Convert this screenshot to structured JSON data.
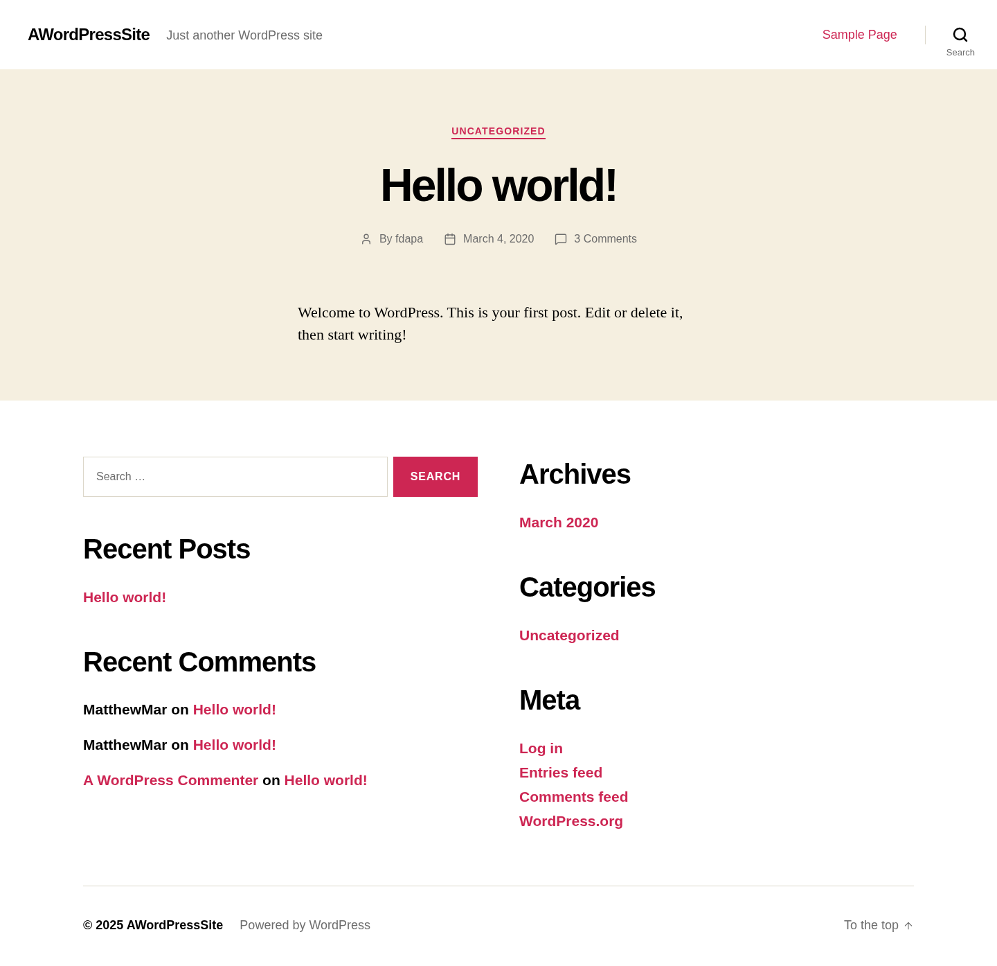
{
  "header": {
    "site_title": "AWordPressSite",
    "tagline": "Just another WordPress site",
    "menu": [
      {
        "label": "Sample Page"
      }
    ],
    "search_toggle": {
      "label": "Search"
    }
  },
  "post": {
    "category": "UNCATEGORIZED",
    "title": "Hello world!",
    "meta": [
      {
        "kind": "author",
        "text": "By fdapa"
      },
      {
        "kind": "date",
        "text": "March 4, 2020"
      },
      {
        "kind": "comments",
        "text": "3 Comments"
      }
    ],
    "body": "Welcome to WordPress. This is your first post. Edit or delete it, then start writing!"
  },
  "widget_columns": [
    {
      "widgets": [
        {
          "kind": "search",
          "placeholder": "Search …",
          "button": "SEARCH"
        },
        {
          "kind": "links",
          "title": "Recent Posts",
          "items": [
            "Hello world!"
          ]
        },
        {
          "kind": "comments",
          "title": "Recent Comments",
          "items": [
            {
              "author": "MatthewMar",
              "author_link": false,
              "joiner": "on",
              "post": "Hello world!"
            },
            {
              "author": "MatthewMar",
              "author_link": false,
              "joiner": "on",
              "post": "Hello world!"
            },
            {
              "author": "A WordPress Commenter",
              "author_link": true,
              "joiner": "on",
              "post": "Hello world!"
            }
          ]
        }
      ]
    },
    {
      "widgets": [
        {
          "kind": "links",
          "title": "Archives",
          "items": [
            "March 2020"
          ]
        },
        {
          "kind": "links",
          "title": "Categories",
          "items": [
            "Uncategorized"
          ]
        },
        {
          "kind": "links",
          "title": "Meta",
          "items": [
            "Log in",
            "Entries feed",
            "Comments feed",
            "WordPress.org"
          ]
        }
      ]
    }
  ],
  "footer": {
    "copyright": "© 2025 AWordPressSite",
    "powered": "Powered by WordPress",
    "to_top": "To the top"
  }
}
